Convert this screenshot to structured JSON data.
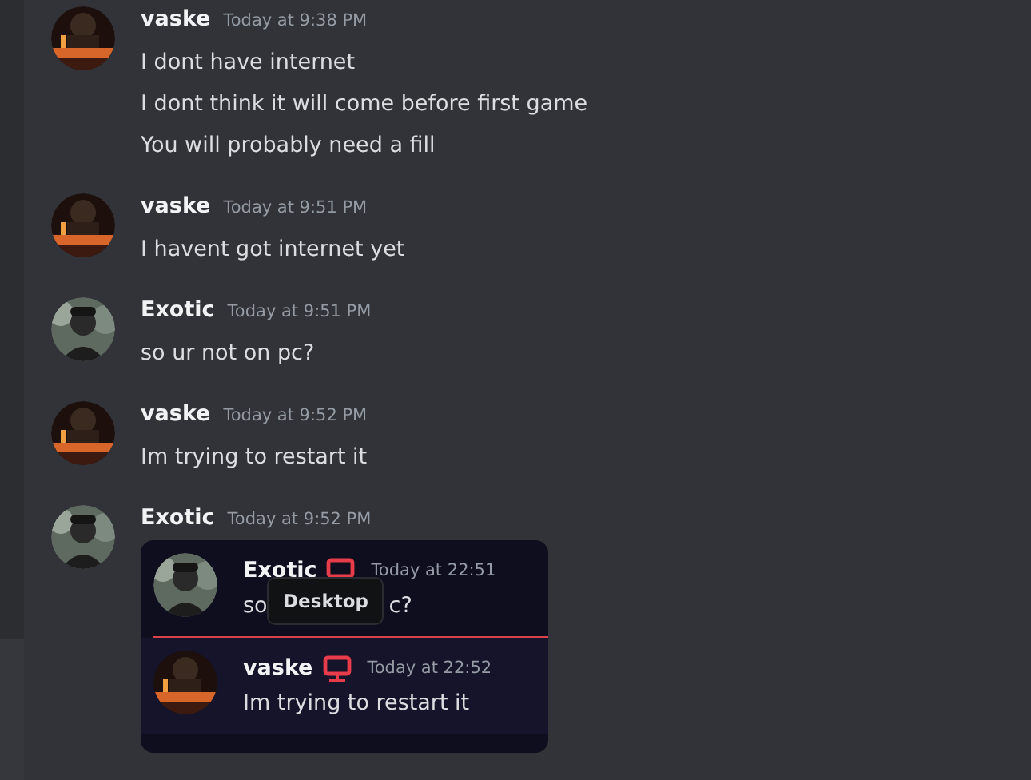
{
  "messages": [
    {
      "author": "vaske",
      "time": "Today at 9:38 PM",
      "lines": [
        "I dont have internet",
        "I dont think it will come before first game",
        "You will probably need a fill"
      ]
    },
    {
      "author": "vaske",
      "time": "Today at 9:51 PM",
      "lines": [
        "I havent got internet yet"
      ]
    },
    {
      "author": "Exotic",
      "time": "Today at 9:51 PM",
      "lines": [
        "so ur not on pc?"
      ]
    },
    {
      "author": "vaske",
      "time": "Today at 9:52 PM",
      "lines": [
        "Im trying to restart it"
      ]
    },
    {
      "author": "Exotic",
      "time": "Today at 9:52 PM",
      "embed": {
        "messages": [
          {
            "author": "Exotic",
            "time": "Today at 22:51",
            "text_parts": [
              "so",
              "c?"
            ],
            "tooltip": "Desktop"
          },
          {
            "author": "vaske",
            "time": "Today at 22:52",
            "text_parts": [
              "Im trying to restart it"
            ]
          }
        ]
      }
    }
  ]
}
